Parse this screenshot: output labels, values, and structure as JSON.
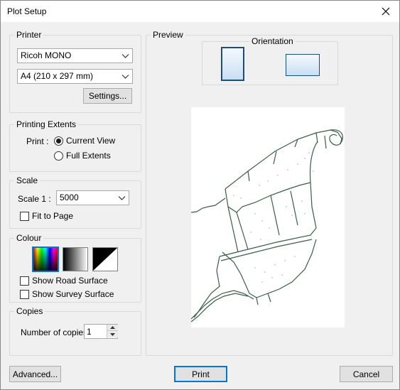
{
  "window": {
    "title": "Plot Setup"
  },
  "printer": {
    "group_title": "Printer",
    "printer_name": "Ricoh MONO",
    "paper_size": "A4 (210 x 297 mm)",
    "settings_label": "Settings..."
  },
  "extents": {
    "group_title": "Printing Extents",
    "print_label": "Print :",
    "options": [
      "Current View",
      "Full Extents"
    ],
    "selected": "Current View"
  },
  "scale": {
    "group_title": "Scale",
    "scale_label": "Scale 1 :",
    "value": "5000",
    "fit_to_page": "Fit to Page"
  },
  "colour": {
    "group_title": "Colour",
    "modes": [
      "full-colour",
      "greyscale",
      "black-and-white"
    ],
    "selected_mode": "full-colour",
    "show_road_surface": "Show Road Surface",
    "show_survey_surface": "Show Survey Surface"
  },
  "copies": {
    "group_title": "Copies",
    "label": "Number of copies",
    "value": "1"
  },
  "preview": {
    "group_title": "Preview",
    "orientation_title": "Orientation",
    "selected_orientation": "portrait",
    "line_color": "#3a5e48"
  },
  "footer": {
    "advanced_label": "Advanced...",
    "print_label": "Print",
    "cancel_label": "Cancel"
  },
  "icons": {
    "close": "close-icon",
    "dropdown": "chevron-down-icon",
    "spin_up": "spin-up-icon",
    "spin_down": "spin-down-icon"
  }
}
